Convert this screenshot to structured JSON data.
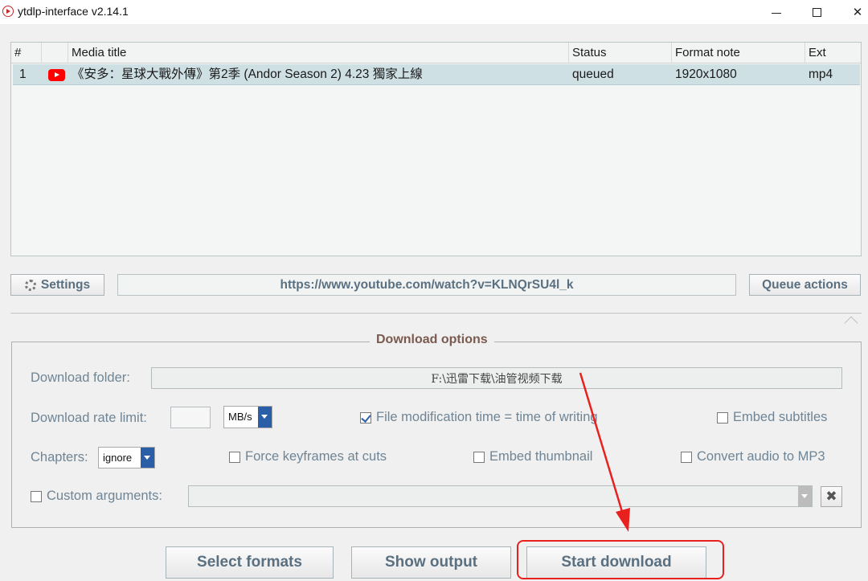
{
  "window": {
    "title": "ytdlp-interface v2.14.1",
    "minimize_glyph": "",
    "close_glyph": "✕"
  },
  "table": {
    "columns": [
      "#",
      "",
      "Media title",
      "Status",
      "Format note",
      "Ext"
    ],
    "rows": [
      {
        "index": "1",
        "source_icon": "youtube-icon",
        "title": "《安多：星球大戰外傳》第2季 (Andor Season 2) 4.23 獨家上線",
        "status": "queued",
        "format_note": "1920x1080",
        "ext": "mp4"
      }
    ]
  },
  "toolbar": {
    "settings_label": "Settings",
    "url_value": "https://www.youtube.com/watch?v=KLNQrSU4l_k",
    "queue_actions_label": "Queue actions"
  },
  "options": {
    "group_title": "Download options",
    "download_folder_label": "Download folder:",
    "download_folder_value": "F:\\迅雷下载\\油管视频下载",
    "rate_limit_label": "Download rate limit:",
    "rate_limit_value": "",
    "rate_unit": "MB/s",
    "file_mod_time_label": "File modification time = time of writing",
    "file_mod_time_checked": true,
    "embed_subtitles_label": "Embed subtitles",
    "chapters_label": "Chapters:",
    "chapters_value": "ignore",
    "force_keyframes_label": "Force keyframes at cuts",
    "embed_thumbnail_label": "Embed thumbnail",
    "convert_audio_label": "Convert audio to MP3",
    "custom_args_label": "Custom arguments:",
    "custom_args_value": "",
    "clear_glyph": "✖"
  },
  "actions": {
    "select_formats_label": "Select formats",
    "show_output_label": "Show output",
    "start_download_label": "Start download"
  },
  "colors": {
    "annotation_red": "#e8201e",
    "row_selected": "#cfe0e4",
    "label_text": "#6f8595"
  }
}
